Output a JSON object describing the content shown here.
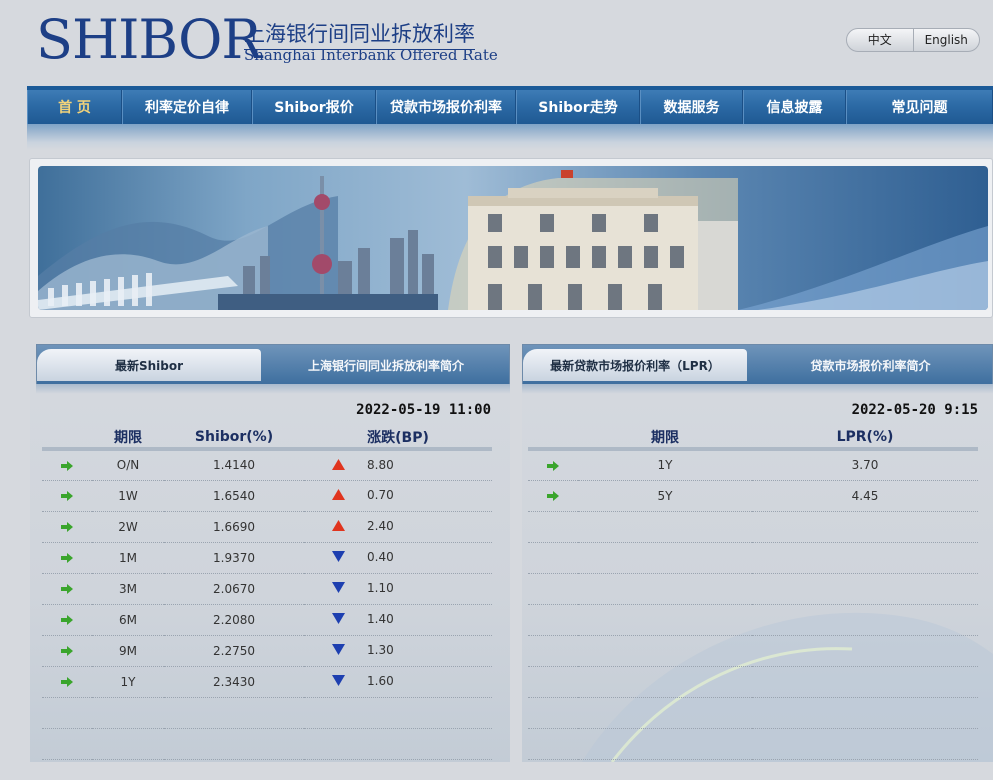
{
  "header": {
    "logo_main": "SHIBOR",
    "logo_cn": "上海银行间同业拆放利率",
    "logo_en": "Shanghai Interbank Offered Rate",
    "lang": [
      "中文",
      "English"
    ]
  },
  "nav": {
    "items": [
      "首 页",
      "利率定价自律",
      "Shibor报价",
      "贷款市场报价利率",
      "Shibor走势",
      "数据服务",
      "信息披露",
      "常见问题"
    ]
  },
  "shibor_panel": {
    "tab_active": "最新Shibor",
    "tab_inactive": "上海银行间同业拆放利率简介",
    "timestamp": "2022-05-19 11:00",
    "headers": [
      "期限",
      "Shibor(%)",
      "涨跌(BP)"
    ],
    "rows": [
      {
        "term": "O/N",
        "rate": "1.4140",
        "direction": "up",
        "change": "8.80"
      },
      {
        "term": "1W",
        "rate": "1.6540",
        "direction": "up",
        "change": "0.70"
      },
      {
        "term": "2W",
        "rate": "1.6690",
        "direction": "up",
        "change": "2.40"
      },
      {
        "term": "1M",
        "rate": "1.9370",
        "direction": "down",
        "change": "0.40"
      },
      {
        "term": "3M",
        "rate": "2.0670",
        "direction": "down",
        "change": "1.10"
      },
      {
        "term": "6M",
        "rate": "2.2080",
        "direction": "down",
        "change": "1.40"
      },
      {
        "term": "9M",
        "rate": "2.2750",
        "direction": "down",
        "change": "1.30"
      },
      {
        "term": "1Y",
        "rate": "2.3430",
        "direction": "down",
        "change": "1.60"
      }
    ]
  },
  "lpr_panel": {
    "tab_active": "最新贷款市场报价利率（LPR）",
    "tab_inactive": "贷款市场报价利率简介",
    "timestamp": "2022-05-20 9:15",
    "headers": [
      "期限",
      "LPR(%)"
    ],
    "rows": [
      {
        "term": "1Y",
        "rate": "3.70"
      },
      {
        "term": "5Y",
        "rate": "4.45"
      }
    ]
  },
  "colors": {
    "brand_blue": "#1d3f86",
    "nav_blue": "#2c6aa5",
    "up_red": "#e0341e",
    "down_blue": "#1d3fb0",
    "arrow_green": "#3aa52c"
  }
}
